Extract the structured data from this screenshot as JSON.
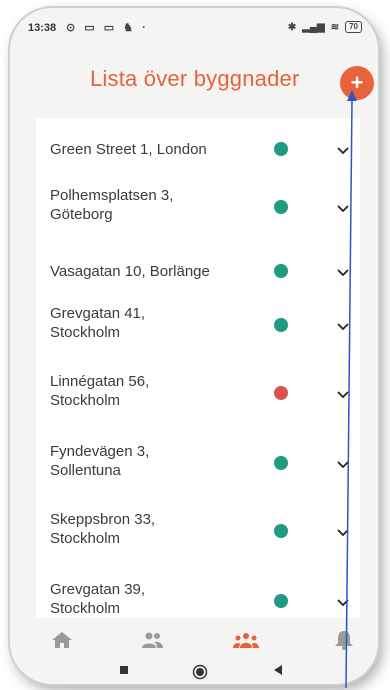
{
  "status_bar": {
    "time": "13:38",
    "left_icons": "⊙ ▭ ▭ ♞ ·",
    "battery": "70"
  },
  "header": {
    "title": "Lista över byggnader",
    "add_label": "+"
  },
  "buildings": [
    {
      "name": "Green Street 1, London",
      "status": "ok",
      "color": "#1e9a84"
    },
    {
      "name": "Polhemsplatsen 3, Göteborg",
      "status": "ok",
      "color": "#1e9a84"
    },
    {
      "name": "Vasagatan 10, Borlänge",
      "status": "ok",
      "color": "#1e9a84"
    },
    {
      "name": "Grevgatan 41, Stockholm",
      "status": "ok",
      "color": "#1e9a84"
    },
    {
      "name": "Linnégatan 56, Stockholm",
      "status": "alert",
      "color": "#d9534f"
    },
    {
      "name": "Fyndevägen 3, Sollentuna",
      "status": "ok",
      "color": "#1e9a84"
    },
    {
      "name": "Skeppsbron 33, Stockholm",
      "status": "ok",
      "color": "#1e9a84"
    },
    {
      "name": "Grevgatan 39, Stockholm",
      "status": "ok",
      "color": "#1e9a84"
    }
  ],
  "bottom_nav": {
    "items": [
      {
        "icon": "home-icon",
        "active": false
      },
      {
        "icon": "users-icon",
        "active": false
      },
      {
        "icon": "group-icon",
        "active": true
      },
      {
        "icon": "bell-icon",
        "active": false
      }
    ]
  },
  "colors": {
    "accent": "#e8623a",
    "ok": "#1e9a84",
    "alert": "#d9534f",
    "nav_inactive": "#9a9a9a"
  }
}
